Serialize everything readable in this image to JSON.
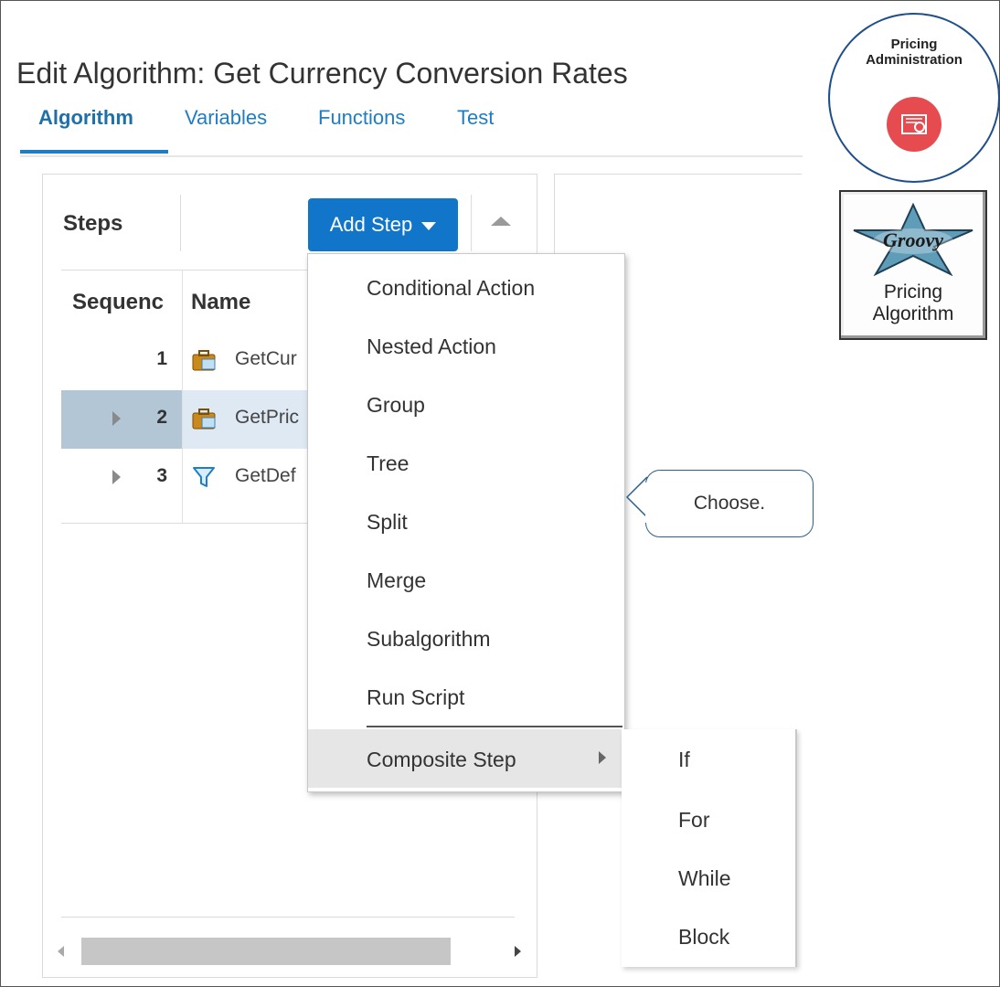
{
  "page": {
    "title": "Edit Algorithm: Get Currency Conversion Rates"
  },
  "tabs": [
    {
      "label": "Algorithm",
      "active": true
    },
    {
      "label": "Variables",
      "active": false
    },
    {
      "label": "Functions",
      "active": false
    },
    {
      "label": "Test",
      "active": false
    }
  ],
  "steps_panel": {
    "title": "Steps",
    "add_step_label": "Add Step",
    "columns": [
      "Sequenc",
      "Name"
    ],
    "rows": [
      {
        "sequence": "1",
        "name": "GetCur",
        "icon": "action-briefcase-icon",
        "expandable": false,
        "selected": false
      },
      {
        "sequence": "2",
        "name": "GetPric",
        "icon": "action-briefcase-icon",
        "expandable": true,
        "selected": true
      },
      {
        "sequence": "3",
        "name": "GetDef",
        "icon": "filter-funnel-icon",
        "expandable": true,
        "selected": false
      }
    ]
  },
  "add_step_menu": {
    "items": [
      "Conditional Action",
      "Nested Action",
      "Group",
      "Tree",
      "Split",
      "Merge",
      "Subalgorithm",
      "Run Script",
      "Composite Step"
    ],
    "highlighted": "Composite Step"
  },
  "composite_submenu": {
    "items": [
      "If",
      "For",
      "While",
      "Block"
    ]
  },
  "callout": {
    "text": "Choose."
  },
  "badges": {
    "admin_line1": "Pricing",
    "admin_line2": "Administration",
    "algo_line1": "Pricing",
    "algo_line2": "Algorithm",
    "groovy_text": "Groovy"
  },
  "colors": {
    "accent": "#1176c9",
    "tab_link": "#1f7dc1",
    "selected_row": "#dfe9f4",
    "admin_icon": "#e54b4f"
  }
}
